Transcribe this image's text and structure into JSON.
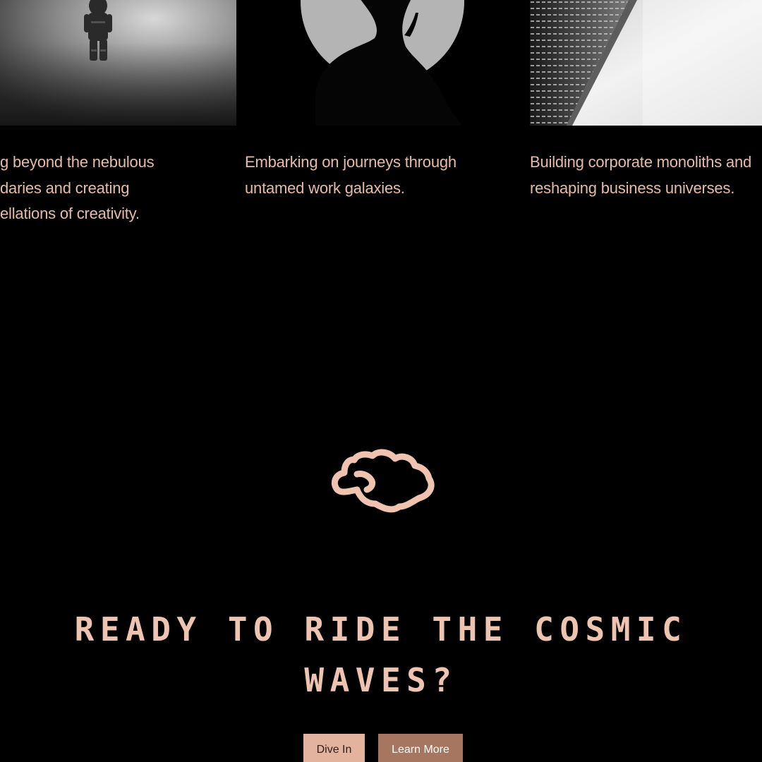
{
  "cards": [
    {
      "image": "astronaut-in-fog",
      "lines": [
        "g beyond the nebulous",
        "daries and creating",
        "ellations of creativity."
      ]
    },
    {
      "image": "silhouette-with-moon",
      "lines": [
        "Embarking on journeys through",
        "untamed work galaxies."
      ]
    },
    {
      "image": "skyscraper-in-mist",
      "lines": [
        "Building corporate monoliths and",
        "reshaping business universes."
      ]
    }
  ],
  "logo": {
    "icon": "cloud-icon"
  },
  "cta": {
    "title_lines": [
      "READY TO RIDE THE COSMIC",
      "WAVES?"
    ],
    "primary_label": "Dive In",
    "secondary_label": "Learn More"
  },
  "colors": {
    "background": "#000000",
    "text_accent": "#e7bba6",
    "title": "#eec4b0",
    "button_primary": "#e3b39e",
    "button_secondary": "#a77661"
  }
}
